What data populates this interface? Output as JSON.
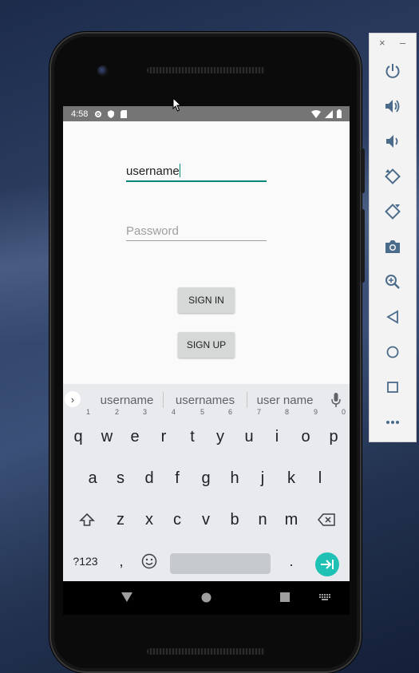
{
  "status_bar": {
    "time": "4:58"
  },
  "form": {
    "username_value": "username",
    "password_placeholder": "Password",
    "sign_in_label": "SIGN IN",
    "sign_up_label": "SIGN UP"
  },
  "keyboard": {
    "suggestions": [
      "username",
      "usernames",
      "user name"
    ],
    "row1": [
      {
        "key": "q",
        "hint": "1"
      },
      {
        "key": "w",
        "hint": "2"
      },
      {
        "key": "e",
        "hint": "3"
      },
      {
        "key": "r",
        "hint": "4"
      },
      {
        "key": "t",
        "hint": "5"
      },
      {
        "key": "y",
        "hint": "6"
      },
      {
        "key": "u",
        "hint": "7"
      },
      {
        "key": "i",
        "hint": "8"
      },
      {
        "key": "o",
        "hint": "9"
      },
      {
        "key": "p",
        "hint": "0"
      }
    ],
    "row2": [
      "a",
      "s",
      "d",
      "f",
      "g",
      "h",
      "j",
      "k",
      "l"
    ],
    "row3": [
      "z",
      "x",
      "c",
      "v",
      "b",
      "n",
      "m"
    ],
    "symbols_label": "?123",
    "comma": ",",
    "period": "."
  },
  "colors": {
    "accent": "#00897b",
    "enter_key": "#1ec1b4",
    "status_bar": "#757575",
    "button": "#d6d7d7"
  },
  "emulator_panel": {
    "tools": [
      "power-icon",
      "volume-up-icon",
      "volume-down-icon",
      "rotate-left-icon",
      "rotate-right-icon",
      "camera-icon",
      "zoom-icon",
      "back-icon",
      "home-icon",
      "overview-icon",
      "more-icon"
    ]
  }
}
